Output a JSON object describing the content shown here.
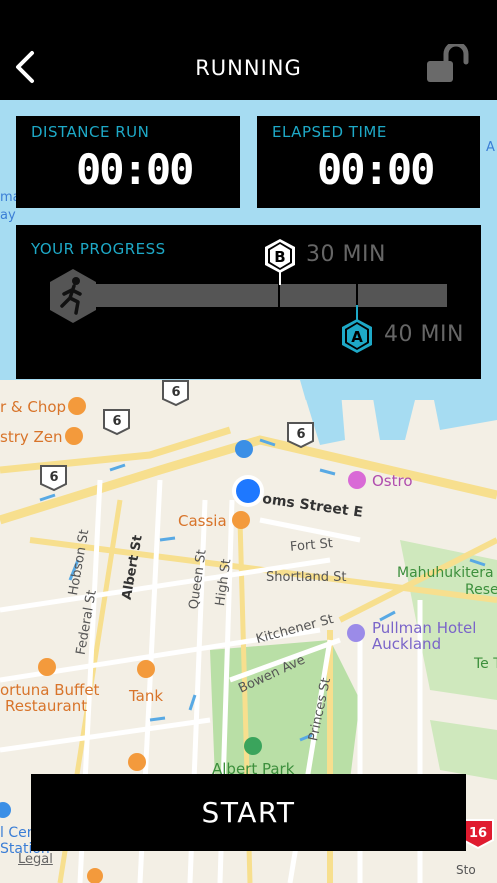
{
  "header": {
    "title": "RUNNING"
  },
  "stats": {
    "distance_label": "DISTANCE RUN",
    "distance_value": "00:00",
    "elapsed_label": "ELAPSED TIME",
    "elapsed_value": "00:00"
  },
  "progress": {
    "label": "YOUR PROGRESS",
    "marker_b": {
      "letter": "B",
      "text": "30 MIN"
    },
    "marker_a": {
      "letter": "A",
      "text": "40 MIN"
    }
  },
  "start_label": "START",
  "map": {
    "labels": {
      "chop": "r & Chop",
      "pastry": "stry Zen",
      "cassia": "Cassia",
      "street_e": "oms Street E",
      "fort": "Fort St",
      "shortland": "Shortland St",
      "hobson": "Hobson St",
      "albert": "Albert St",
      "queen": "Queen St",
      "high": "High St",
      "federal": "Federal St",
      "kitchener": "Kitchener St",
      "bowen": "Bowen Ave",
      "princes": "Princes St",
      "ostro": "Ostro",
      "mahu1": "Mahuhukitera",
      "mahu2": "Rese",
      "pullman1": "Pullman Hotel",
      "pullman2": "Auckland",
      "fortuna1": "ortuna Buffet",
      "fortuna2": "Restaurant",
      "tank": "Tank",
      "albert_park": "Albert Park",
      "te": "Te T",
      "cen": "l Cen",
      "station": "Station",
      "legal": "Legal",
      "edge_a": "A",
      "edge_ma": "ma",
      "edge_ay": "ay",
      "edge_st": "Sto"
    },
    "route_badges": [
      "6",
      "6",
      "6",
      "6",
      "16"
    ]
  },
  "colors": {
    "accent": "#1ea9c7",
    "water": "#a6dcf2",
    "location": "#1e78ff",
    "park": "#b9dfa6"
  }
}
